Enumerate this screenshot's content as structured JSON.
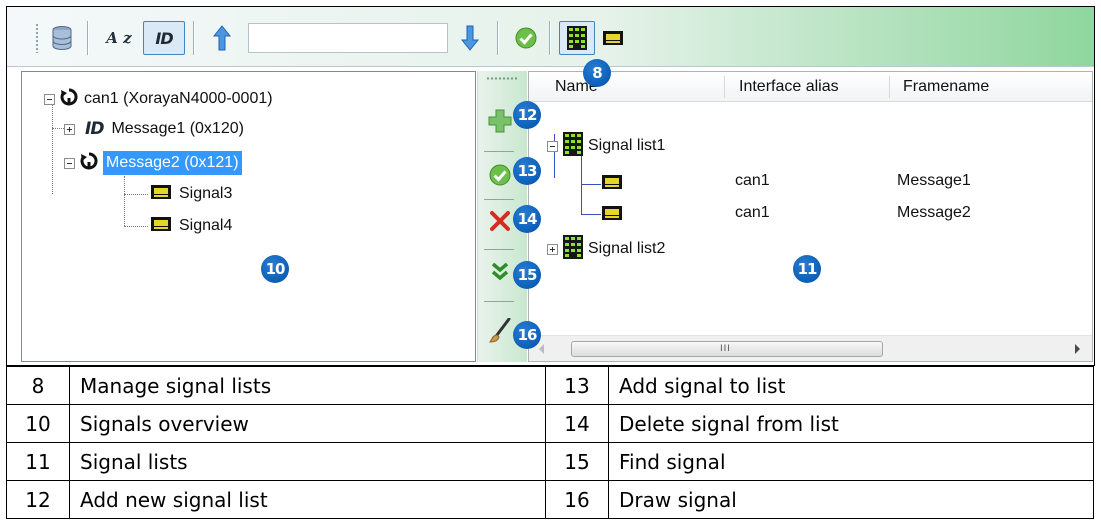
{
  "toolbar": {
    "search_value": "",
    "icons": [
      "database-icon",
      "sort-az-icon",
      "id-toggle-icon",
      "arrow-up-icon",
      "arrow-down-icon",
      "check-icon",
      "signal-list-icon",
      "signal-icon"
    ],
    "sort_label": "A z",
    "id_label": "ID"
  },
  "badges": {
    "b8": "8",
    "b10": "10",
    "b11": "11",
    "b12": "12",
    "b13": "13",
    "b14": "14",
    "b15": "15",
    "b16": "16"
  },
  "tree": {
    "root": "can1 (XorayaN4000-0001)",
    "message1": "Message1 (0x120)",
    "message2": "Message2 (0x121)",
    "signal3": "Signal3",
    "signal4": "Signal4"
  },
  "grid": {
    "columns": [
      "Name",
      "Interface alias",
      "Framename"
    ],
    "list1": "Signal list1",
    "list2": "Signal list2",
    "rows": [
      {
        "alias": "can1",
        "frame": "Message1"
      },
      {
        "alias": "can1",
        "frame": "Message2"
      }
    ],
    "scroll_grip": "III"
  },
  "legend": [
    {
      "n1": "8",
      "t1": "Manage signal lists",
      "n2": "13",
      "t2": "Add signal to list"
    },
    {
      "n1": "10",
      "t1": "Signals overview",
      "n2": "14",
      "t2": "Delete signal from list"
    },
    {
      "n1": "11",
      "t1": "Signal lists",
      "n2": "15",
      "t2": "Find signal"
    },
    {
      "n1": "12",
      "t1": "Add new signal list",
      "n2": "16",
      "t2": "Draw signal"
    }
  ],
  "colors": {
    "accent": "#0b5fb8",
    "selection": "#3399ff",
    "toolbar_gradient_end": "#8fd69e"
  }
}
